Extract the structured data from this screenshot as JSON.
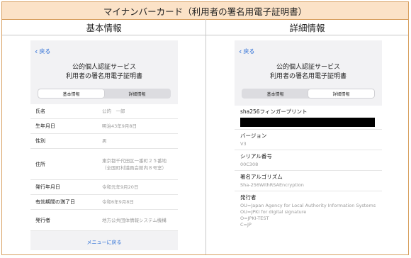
{
  "title": "マイナンバーカード（利用者の署名用電子証明書）",
  "columns": {
    "left": "基本情報",
    "right": "詳細情報"
  },
  "left_screen": {
    "back_label": "戻る",
    "title_line1": "公的個人認証サービス",
    "title_line2": "利用者の署名用電子証明書",
    "tabs": [
      {
        "label": "基本情報",
        "active": true
      },
      {
        "label": "詳細情報",
        "active": false
      }
    ],
    "rows": [
      {
        "key": "氏名",
        "value": "公的　一郎"
      },
      {
        "key": "生年月日",
        "value": "明治43年9月8日"
      },
      {
        "key": "性別",
        "value": "男"
      },
      {
        "key": "住所",
        "value": "東京都千代田区一番町２５番地（全国町村議員会館内８号室）"
      },
      {
        "key": "発行年月日",
        "value": "令和元年9月20日"
      },
      {
        "key": "有効期間の満了日",
        "value": "令和6年9月8日"
      },
      {
        "key": "発行者",
        "value": "地方公共団体情報システム機構"
      }
    ],
    "menu_back_label": "メニューに戻る"
  },
  "right_screen": {
    "back_label": "戻る",
    "title_line1": "公的個人認証サービス",
    "title_line2": "利用者の署名用電子証明書",
    "tabs": [
      {
        "label": "基本情報",
        "active": false
      },
      {
        "label": "詳細情報",
        "active": true
      }
    ],
    "fingerprint_label": "sha256フィンガープリント",
    "version_label": "バージョン",
    "version_value": "V3",
    "serial_label": "シリアル番号",
    "serial_value": "00C308",
    "algo_label": "署名アルゴリズム",
    "algo_value": "Sha-256WithRSAEncryption",
    "issuer_label": "発行者",
    "issuer_lines": [
      "OU=Japan Agency for Local Authority Information Systems",
      "OU=JPKI for digital signature",
      "O=JPKI-TEST",
      "C=JP"
    ]
  },
  "colors": {
    "accent": "#2d6fd6",
    "header_bg": "#fbe2c7",
    "border": "#d8a060"
  }
}
